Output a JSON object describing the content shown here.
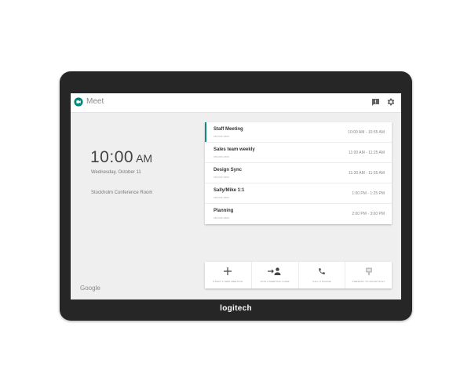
{
  "app": {
    "title": "Meet"
  },
  "clock": {
    "time": "10:00",
    "ampm": "AM",
    "date": "Wednesday, October 11",
    "room": "Stockholm Conference Room"
  },
  "footer": {
    "google": "Google"
  },
  "meetings": [
    {
      "title": "Staff Meeting",
      "code": "xxx-xxx-xxxx",
      "time": "10:00 AM - 10:55 AM",
      "active": true
    },
    {
      "title": "Sales team weekly",
      "code": "xxx-xxx-xxxx",
      "time": "11:00 AM - 11:25 AM",
      "active": false
    },
    {
      "title": "Design Sync",
      "code": "xxx-xxx-xxxx",
      "time": "11:30 AM - 11:55 AM",
      "active": false
    },
    {
      "title": "Sally/Mike 1:1",
      "code": "xxx-xxx-xxxx",
      "time": "1:00 PM - 1:25 PM",
      "active": false
    },
    {
      "title": "Planning",
      "code": "xxx-xxx-xxxx",
      "time": "2:00 PM - 3:00 PM",
      "active": false
    }
  ],
  "actions": [
    {
      "label": "START A NEW MEETING",
      "icon": "plus-icon"
    },
    {
      "label": "JOIN A MEETING CODE",
      "icon": "join-person-icon"
    },
    {
      "label": "CALL A PHONE",
      "icon": "phone-icon"
    },
    {
      "label": "PRESENT TO ROOM ONLY",
      "icon": "present-icon"
    }
  ],
  "device": {
    "brand": "logitech"
  },
  "colors": {
    "accent": "#128c7e",
    "bezel": "#262626",
    "screen": "#efefef"
  }
}
